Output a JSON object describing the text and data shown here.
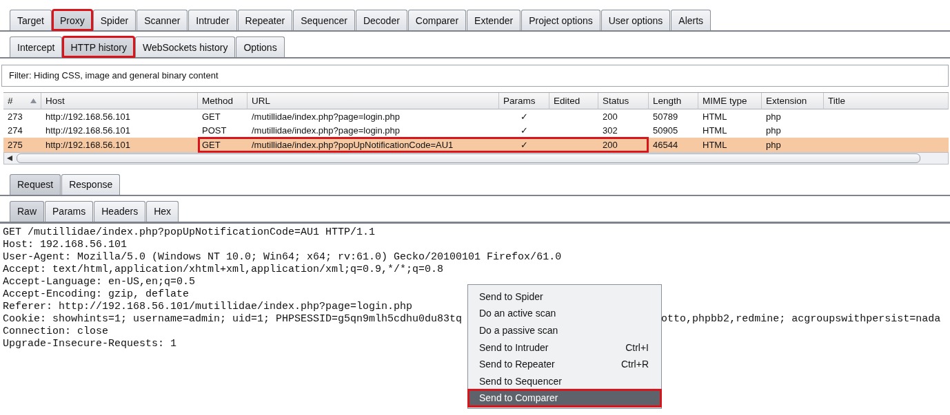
{
  "top_tabs": [
    {
      "label": "Target",
      "selected": false,
      "highlighted": false
    },
    {
      "label": "Proxy",
      "selected": true,
      "highlighted": true
    },
    {
      "label": "Spider",
      "selected": false,
      "highlighted": false
    },
    {
      "label": "Scanner",
      "selected": false,
      "highlighted": false
    },
    {
      "label": "Intruder",
      "selected": false,
      "highlighted": false
    },
    {
      "label": "Repeater",
      "selected": false,
      "highlighted": false
    },
    {
      "label": "Sequencer",
      "selected": false,
      "highlighted": false
    },
    {
      "label": "Decoder",
      "selected": false,
      "highlighted": false
    },
    {
      "label": "Comparer",
      "selected": false,
      "highlighted": false
    },
    {
      "label": "Extender",
      "selected": false,
      "highlighted": false
    },
    {
      "label": "Project options",
      "selected": false,
      "highlighted": false
    },
    {
      "label": "User options",
      "selected": false,
      "highlighted": false
    },
    {
      "label": "Alerts",
      "selected": false,
      "highlighted": false
    }
  ],
  "sub_tabs": [
    {
      "label": "Intercept",
      "selected": false,
      "highlighted": false
    },
    {
      "label": "HTTP history",
      "selected": true,
      "highlighted": true
    },
    {
      "label": "WebSockets history",
      "selected": false,
      "highlighted": false
    },
    {
      "label": "Options",
      "selected": false,
      "highlighted": false
    }
  ],
  "filter": "Filter: Hiding CSS, image and general binary content",
  "table": {
    "columns": [
      {
        "label": "#",
        "sorted": true
      },
      {
        "label": "Host",
        "sorted": false
      },
      {
        "label": "Method",
        "sorted": false
      },
      {
        "label": "URL",
        "sorted": false
      },
      {
        "label": "Params",
        "sorted": false
      },
      {
        "label": "Edited",
        "sorted": false
      },
      {
        "label": "Status",
        "sorted": false
      },
      {
        "label": "Length",
        "sorted": false
      },
      {
        "label": "MIME type",
        "sorted": false
      },
      {
        "label": "Extension",
        "sorted": false
      },
      {
        "label": "Title",
        "sorted": false
      }
    ],
    "rows": [
      {
        "number": "273",
        "host": "http://192.168.56.101",
        "method": "GET",
        "url": "/mutillidae/index.php?page=login.php",
        "params": "✓",
        "status": "200",
        "length": "50789",
        "mime_type": "HTML",
        "extension": "php",
        "selected": false,
        "highlighted": false
      },
      {
        "number": "274",
        "host": "http://192.168.56.101",
        "method": "POST",
        "url": "/mutillidae/index.php?page=login.php",
        "params": "✓",
        "status": "302",
        "length": "50905",
        "mime_type": "HTML",
        "extension": "php",
        "selected": false,
        "highlighted": false
      },
      {
        "number": "275",
        "host": "http://192.168.56.101",
        "method": "GET",
        "url": "/mutillidae/index.php?popUpNotificationCode=AU1",
        "params": "✓",
        "status": "200",
        "length": "46544",
        "mime_type": "HTML",
        "extension": "php",
        "selected": true,
        "highlighted": true
      }
    ]
  },
  "message_tabs": [
    {
      "label": "Request",
      "selected": true
    },
    {
      "label": "Response",
      "selected": false
    }
  ],
  "view_tabs": [
    {
      "label": "Raw",
      "selected": true
    },
    {
      "label": "Params",
      "selected": false
    },
    {
      "label": "Headers",
      "selected": false
    },
    {
      "label": "Hex",
      "selected": false
    }
  ],
  "request_lines": [
    {
      "text": "GET /mutillidae/index.php?popUpNotificationCode=AU1 HTTP/1.1"
    },
    {
      "text": "Host: 192.168.56.101"
    },
    {
      "text": "User-Agent: Mozilla/5.0 (Windows NT 10.0; Win64; x64; rv:61.0) Gecko/20100101 Firefox/61.0"
    },
    {
      "text": "Accept: text/html,application/xhtml+xml,application/xml;q=0.9,*/*;q=0.8"
    },
    {
      "text": "Accept-Language: en-US,en;q=0.5"
    },
    {
      "text": "Accept-Encoding: gzip, deflate"
    },
    {
      "text": "Referer: http://192.168.56.101/mutillidae/index.php?page=login.php"
    },
    {
      "text": "Cookie: showhints=1; username=admin; uid=1; PHPSESSID=g5qn9mlh5cdhu0du83tq",
      "continued": "otto,phpbb2,redmine; acgroupswithpersist=nada"
    },
    {
      "text": "Connection: close"
    },
    {
      "text": "Upgrade-Insecure-Requests: 1"
    }
  ],
  "context_menu": [
    {
      "label": "Send to Spider",
      "selected": false,
      "highlighted": false
    },
    {
      "label": "Do an active scan",
      "selected": false,
      "highlighted": false
    },
    {
      "label": "Do a passive scan",
      "selected": false,
      "highlighted": false
    },
    {
      "label": "Send to Intruder",
      "shortcut": "Ctrl+I",
      "selected": false,
      "highlighted": false
    },
    {
      "label": "Send to Repeater",
      "shortcut": "Ctrl+R",
      "selected": false,
      "highlighted": false
    },
    {
      "label": "Send to Sequencer",
      "selected": false,
      "highlighted": false
    },
    {
      "label": "Send to Comparer",
      "selected": true,
      "highlighted": true
    }
  ]
}
